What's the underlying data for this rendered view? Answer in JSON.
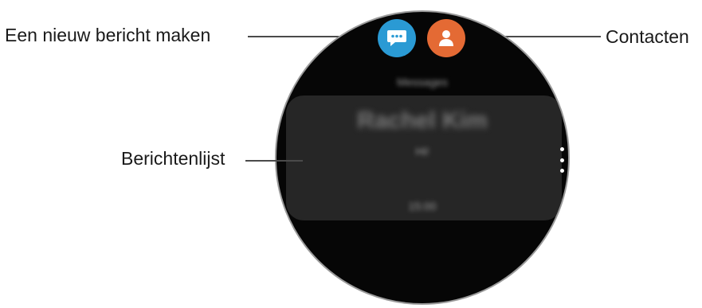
{
  "labels": {
    "new_message": "Een nieuw bericht maken",
    "contacts": "Contacten",
    "message_list": "Berichtenlijst"
  },
  "screen": {
    "header": "Messages",
    "contact_name": "Rachel Kim",
    "message_preview": "Hi!",
    "time": "15:00"
  },
  "icons": {
    "compose": "chat-bubble-icon",
    "contacts": "person-icon",
    "more": "more-vertical-icon"
  },
  "colors": {
    "compose_button": "#2a9ad4",
    "contacts_button": "#e46a34",
    "watch_face": "#060606",
    "list_card": "#262626"
  }
}
